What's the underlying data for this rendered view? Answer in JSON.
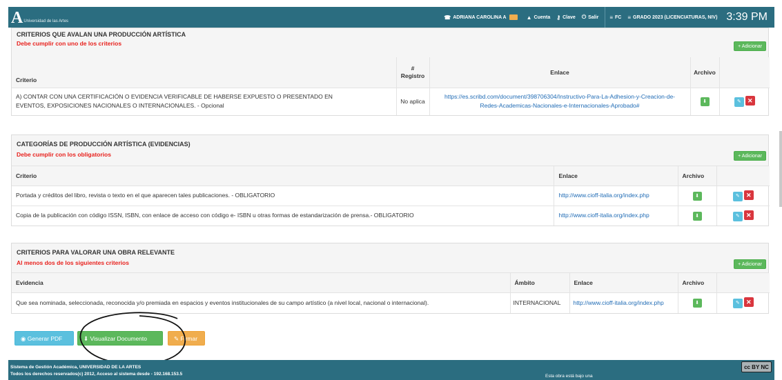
{
  "navbar": {
    "logo_mark": "A",
    "logo_text": "Universidad de las Artes",
    "user": "ADRIANA CAROLINA A",
    "cuenta": "Cuenta",
    "clave": "Clave",
    "salir": "Salir",
    "fc": "FC",
    "grado": "GRADO 2023 (LICENCIATURAS, NIV)",
    "time": "3:39 PM"
  },
  "panel1": {
    "title": "CRITERIOS QUE AVALAN UNA PRODUCCIÓN ARTÍSTICA",
    "subtitle": "Debe cumplir con uno de los criterios",
    "add_label": "+ Adicionar",
    "headers": {
      "criterio": "Criterio",
      "num_hash": "#",
      "num_word": "Registro",
      "enlace": "Enlace",
      "archivo": "Archivo"
    },
    "rows": [
      {
        "criterio_line1": "A) CONTAR CON UNA CERTIFICACIÓN O EVIDENCIA VERIFICABLE DE HABERSE EXPUESTO O PRESENTADO EN",
        "criterio_line2": "EVENTOS, EXPOSICIONES NACIONALES O INTERNACIONALES. - Opcional",
        "registro": "No aplica",
        "enlace_line1": "https://es.scribd.com/document/398706304/Instructivo-Para-La-Adhesion-y-Creacion-de-",
        "enlace_line2": "Redes-Academicas-Nacionales-e-Internacionales-Aprobado#"
      }
    ]
  },
  "panel2": {
    "title": "CATEGORÍAS DE PRODUCCIÓN ARTÍSTICA (EVIDENCIAS)",
    "subtitle": "Debe cumplir con los obligatorios",
    "add_label": "+ Adicionar",
    "headers": {
      "criterio": "Criterio",
      "enlace": "Enlace",
      "archivo": "Archivo"
    },
    "rows": [
      {
        "criterio": "Portada y créditos del libro, revista o texto en el que aparecen tales publicaciones. - OBLIGATORIO",
        "enlace": "http://www.cioff-italia.org/index.php"
      },
      {
        "criterio": "Copia de la publicación con código ISSN, ISBN, con enlace de acceso con código e- ISBN u otras formas de estandarización de prensa.- OBLIGATORIO",
        "enlace": "http://www.cioff-italia.org/index.php"
      }
    ]
  },
  "panel3": {
    "title": "CRITERIOS PARA VALORAR UNA OBRA RELEVANTE",
    "subtitle": "Al menos dos de los siguientes criterios",
    "add_label": "+ Adicionar",
    "headers": {
      "evidencia": "Evidencia",
      "ambito": "Ámbito",
      "enlace": "Enlace",
      "archivo": "Archivo"
    },
    "rows": [
      {
        "evidencia": "Que sea nominada, seleccionada, reconocida y/o premiada en espacios y eventos institucionales de su campo artístico (a nivel local, nacional o internacional).",
        "ambito": "INTERNACIONAL",
        "enlace": "http://www.cioff-italia.org/index.php"
      }
    ]
  },
  "actions": {
    "generar_pdf": "Generar PDF",
    "visualizar": "Visualizar Documento",
    "firmar": "Firmar"
  },
  "footer": {
    "line1": "Sistema de Gestión Académica, UNIVERSIDAD DE LA ARTES",
    "line2": "Todos los derechos reservados(c) 2012, Acceso al sistema desde - 192.168.153.5",
    "license": "Esta obra está bajo una",
    "cc_badge": "cc BY NC"
  },
  "colors": {
    "navbar": "#2b6d80",
    "success": "#5cb85c",
    "info": "#5bc0de",
    "warning": "#f0ad4e",
    "danger": "#d9363e",
    "required_text": "#e8211d",
    "link": "#1f6bb5"
  }
}
